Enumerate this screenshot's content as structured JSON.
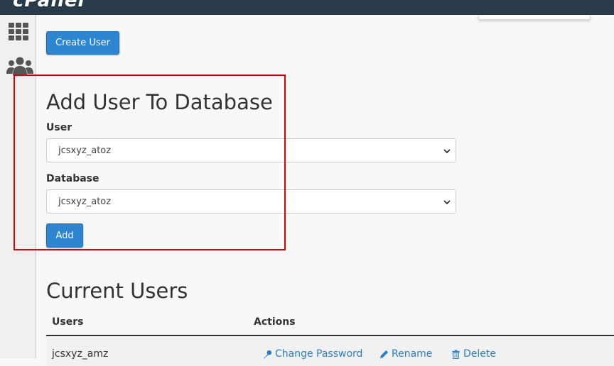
{
  "header": {
    "logo_text": "cPanel"
  },
  "sidebar": {
    "items": [
      {
        "icon": "grid-icon"
      },
      {
        "icon": "users-icon"
      }
    ]
  },
  "create_user": {
    "button_label": "Create User"
  },
  "add_user_to_db": {
    "title": "Add User To Database",
    "user_label": "User",
    "user_value": "jcsxyz_atoz",
    "database_label": "Database",
    "database_value": "jcsxyz_atoz",
    "add_button_label": "Add"
  },
  "current_users": {
    "title": "Current Users",
    "columns": [
      "Users",
      "Actions"
    ],
    "rows": [
      {
        "user": "jcsxyz_amz",
        "actions": [
          "Change Password",
          "Rename",
          "Delete"
        ]
      }
    ]
  },
  "colors": {
    "topbar": "#293a4a",
    "primary_button": "#2e86d0",
    "link": "#2e7fc1",
    "highlight": "#e00000"
  }
}
